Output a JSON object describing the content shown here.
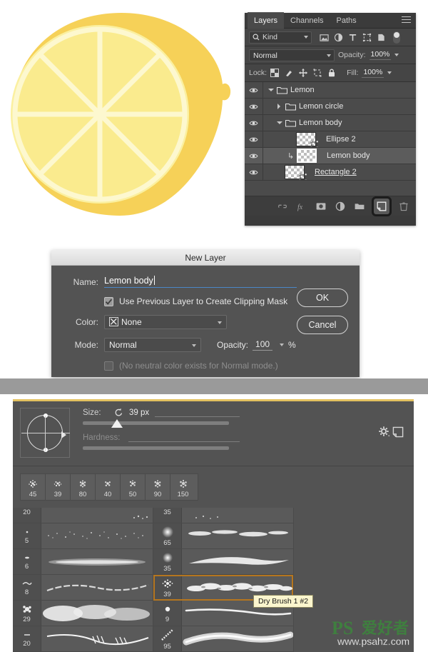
{
  "artwork": {
    "name": "lemon-illustration",
    "body_color": "#f6d158",
    "slice_color": "#fbf0a0",
    "divider_color": "#fdf8cf",
    "ring_color": "#fcf5b8"
  },
  "layers_panel": {
    "tabs": [
      {
        "label": "Layers",
        "active": true
      },
      {
        "label": "Channels",
        "active": false
      },
      {
        "label": "Paths",
        "active": false
      }
    ],
    "menu_icon": "hamburger-menu-icon",
    "filter": {
      "search_icon": "search-icon",
      "kind_label": "Kind",
      "icons": [
        "image-filter-icon",
        "adjustment-filter-icon",
        "type-filter-icon",
        "shape-filter-icon",
        "smart-object-filter-icon"
      ],
      "toggle": "filter-toggle"
    },
    "blend": {
      "mode": "Normal",
      "opacity_label": "Opacity:",
      "opacity_value": "100%"
    },
    "lock": {
      "label": "Lock:",
      "icons": [
        "lock-transparent-pixels-icon",
        "lock-image-pixels-icon",
        "lock-position-icon",
        "lock-artboard-icon",
        "lock-all-icon"
      ],
      "fill_label": "Fill:",
      "fill_value": "100%"
    },
    "layers": [
      {
        "name": "Lemon",
        "type": "group",
        "indent": 0,
        "expanded": true,
        "visible": true,
        "selected": false,
        "clipped": false,
        "thumb": false
      },
      {
        "name": "Lemon circle",
        "type": "group",
        "indent": 1,
        "expanded": false,
        "visible": true,
        "selected": false,
        "clipped": false,
        "thumb": false
      },
      {
        "name": "Lemon body",
        "type": "group",
        "indent": 1,
        "expanded": true,
        "visible": true,
        "selected": false,
        "clipped": false,
        "thumb": false
      },
      {
        "name": "Ellipse 2",
        "type": "shape",
        "indent": 2,
        "expanded": null,
        "visible": true,
        "selected": false,
        "clipped": false,
        "thumb": true
      },
      {
        "name": "Lemon body",
        "type": "shape",
        "indent": 2,
        "expanded": null,
        "visible": true,
        "selected": true,
        "clipped": true,
        "thumb": true
      },
      {
        "name": "Rectangle 2",
        "type": "shape",
        "indent": 1,
        "expanded": null,
        "visible": true,
        "selected": false,
        "clipped": false,
        "thumb": true
      }
    ],
    "footer_buttons": [
      {
        "name": "link-layers-icon",
        "highlighted": false
      },
      {
        "name": "layer-style-fx-icon",
        "highlighted": false
      },
      {
        "name": "add-layer-mask-icon",
        "highlighted": false
      },
      {
        "name": "new-adjustment-layer-icon",
        "highlighted": false
      },
      {
        "name": "new-group-icon",
        "highlighted": false
      },
      {
        "name": "new-layer-icon",
        "highlighted": true
      },
      {
        "name": "delete-layer-icon",
        "highlighted": false
      }
    ]
  },
  "new_layer_dialog": {
    "title": "New Layer",
    "name_label": "Name:",
    "name_value": "Lemon body",
    "clipping_mask_label": "Use Previous Layer to Create Clipping Mask",
    "clipping_mask_checked": true,
    "color_label": "Color:",
    "color_value": "None",
    "mode_label": "Mode:",
    "mode_value": "Normal",
    "opacity_label": "Opacity:",
    "opacity_value": "100",
    "percent_sign": "%",
    "neutral_note": "(No neutral color exists for Normal mode.)",
    "neutral_checked": false,
    "ok_label": "OK",
    "cancel_label": "Cancel"
  },
  "brush_panel": {
    "accent_color": "#e3c161",
    "tip_preview": "brush-angle-preview",
    "size_label": "Size:",
    "size_reset_icon": "reset-icon",
    "size_value": "39 px",
    "hardness_label": "Hardness:",
    "gear_icon": "gear-icon",
    "new_brush_icon": "new-brush-preset-icon",
    "preset_strip": [
      {
        "size": "45"
      },
      {
        "size": "39"
      },
      {
        "size": "80"
      },
      {
        "size": "40"
      },
      {
        "size": "50"
      },
      {
        "size": "90"
      },
      {
        "size": "150"
      }
    ],
    "brush_rows_left": [
      {
        "size": "20",
        "selected": false,
        "stroke": "speckle"
      },
      {
        "size": "5",
        "selected": false,
        "stroke": "fine-scatter"
      },
      {
        "size": "6",
        "selected": false,
        "stroke": "soft-smear"
      },
      {
        "size": "8",
        "selected": false,
        "stroke": "thin-dry"
      },
      {
        "size": "29",
        "selected": false,
        "stroke": "cloud-spray"
      },
      {
        "size": "20",
        "selected": false,
        "stroke": "ribbon-line"
      }
    ],
    "brush_rows_right": [
      {
        "size": "35",
        "selected": false,
        "stroke": "fine-fleck"
      },
      {
        "size": "65",
        "selected": false,
        "stroke": "wide-spray"
      },
      {
        "size": "35",
        "selected": false,
        "stroke": "tapered-wisp"
      },
      {
        "size": "39",
        "selected": true,
        "stroke": "dry-brush"
      },
      {
        "size": "9",
        "selected": false,
        "stroke": "thin-taper"
      },
      {
        "size": "95",
        "selected": false,
        "stroke": "broad-chalk"
      }
    ],
    "tooltip": "Dry Brush 1 #2"
  },
  "watermark": {
    "brand": "PS",
    "cn_text": "爱好者",
    "url": "www.psahz.com",
    "color": "#3f7f3f"
  }
}
